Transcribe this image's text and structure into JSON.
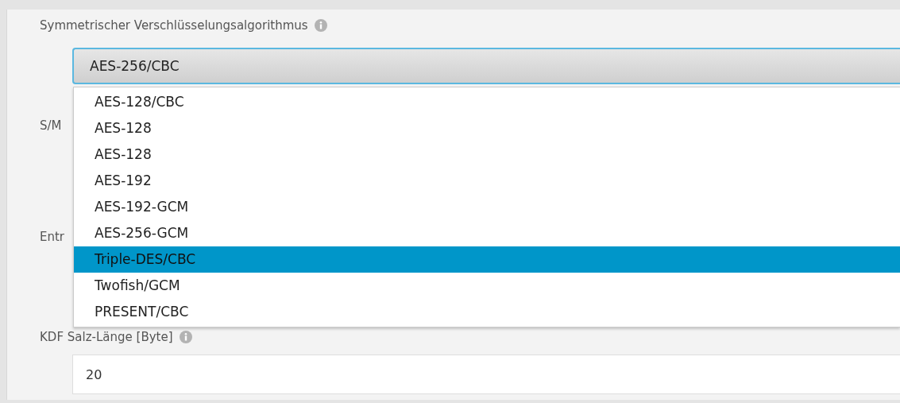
{
  "algorithm": {
    "label": "Symmetrischer Verschlüsselungsalgorithmus",
    "value": "AES-256/CBC",
    "expanded": true,
    "options": [
      {
        "label": "AES-128/CBC",
        "selected": false
      },
      {
        "label": "AES-128",
        "selected": false
      },
      {
        "label": "AES-128",
        "selected": false
      },
      {
        "label": "AES-192",
        "selected": false
      },
      {
        "label": "AES-192-GCM",
        "selected": false
      },
      {
        "label": "AES-256-GCM",
        "selected": false
      },
      {
        "label": "Triple-DES/CBC",
        "selected": true
      },
      {
        "label": "Twofish/GCM",
        "selected": false
      },
      {
        "label": "PRESENT/CBC",
        "selected": false
      }
    ]
  },
  "hidden_labels": [
    "S/M",
    "Entr"
  ],
  "salt_length": {
    "label": "KDF Salz-Länge [Byte]",
    "value": "20"
  }
}
